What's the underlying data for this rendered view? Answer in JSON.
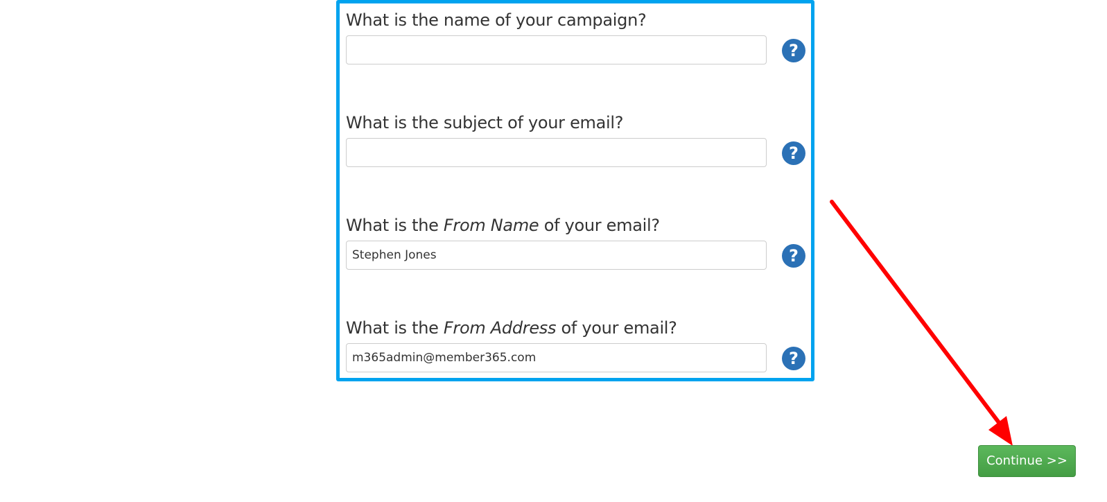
{
  "form": {
    "fields": [
      {
        "label": "What is the name of your campaign?",
        "value": "",
        "help_icon": "question-circle-icon"
      },
      {
        "label": "What is the subject of your email?",
        "value": "",
        "help_icon": "question-circle-icon"
      },
      {
        "label_prefix": "What is the ",
        "label_emphasis": "From Name",
        "label_suffix": " of your email?",
        "value": "Stephen Jones",
        "help_icon": "question-circle-icon"
      },
      {
        "label_prefix": "What is the ",
        "label_emphasis": "From Address",
        "label_suffix": " of your email?",
        "value": "m365admin@member365.com",
        "help_icon": "question-circle-icon"
      }
    ],
    "help_glyph": "?"
  },
  "actions": {
    "continue_label": "Continue >>"
  },
  "colors": {
    "highlight_border": "#00a3ef",
    "help_icon": "#2b71b6",
    "continue_button": "#4cae4c",
    "annotation_arrow": "#ff0000"
  }
}
